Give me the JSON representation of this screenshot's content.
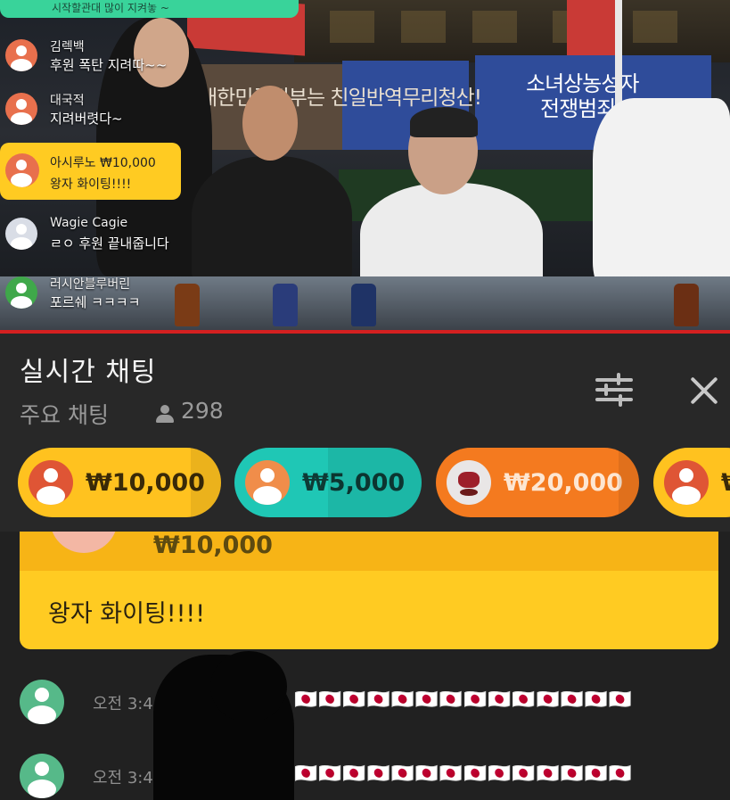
{
  "video": {
    "overlay_top_text": "시작할관대 많이 지켜놓 ~",
    "banners": [
      "대한민국정부는 친일반역무리청산!",
      "소녀상농성자",
      "전쟁범죄"
    ],
    "overlay_chat": [
      {
        "name": "김렉백",
        "text": "후원 폭탄 지려따~~"
      },
      {
        "name": "대국적",
        "text": "지려버렷다~"
      },
      {
        "name": "Wagie Cagie",
        "text": "ㄹㅇ 후원 끝내줍니다"
      },
      {
        "name": "러시안블루버린",
        "text": "포르쉐 ㅋㅋㅋㅋ"
      }
    ],
    "overlay_donation": {
      "name": "아시루노",
      "amount": "₩10,000",
      "text": "왕자 화이팅!!!!"
    }
  },
  "header": {
    "title": "실시간 채팅",
    "subtitle": "주요 채팅",
    "viewer_count": "298"
  },
  "donation_pills": [
    {
      "amount": "₩10,000",
      "color": "#ffc21f",
      "progress": 0.15
    },
    {
      "amount": "₩5,000",
      "color": "#1fc7b5",
      "progress": 0.5
    },
    {
      "amount": "₩20,000",
      "color": "#f47a1f",
      "progress": 0.1
    },
    {
      "amount": "₩",
      "color": "#ffc21f",
      "progress": 0
    }
  ],
  "pinned": {
    "amount": "₩10,000",
    "message": "왕자 화이팅!!!!"
  },
  "chat": [
    {
      "time": "오전 3:4",
      "message": "🇯🇵🇯🇵🇯🇵🇯🇵🇯🇵🇯🇵🇯🇵🇯🇵🇯🇵🇯🇵🇯🇵🇯🇵🇯🇵🇯🇵"
    },
    {
      "time": "오전 3:4",
      "message": "🇯🇵🇯🇵🇯🇵🇯🇵🇯🇵🇯🇵🇯🇵🇯🇵🇯🇵🇯🇵🇯🇵🇯🇵🇯🇵🇯🇵"
    }
  ],
  "colors": {
    "accent_red": "#d42020",
    "panel_bg": "#282828",
    "chat_bg": "#212121",
    "donation_yellow": "#ffcb22"
  }
}
